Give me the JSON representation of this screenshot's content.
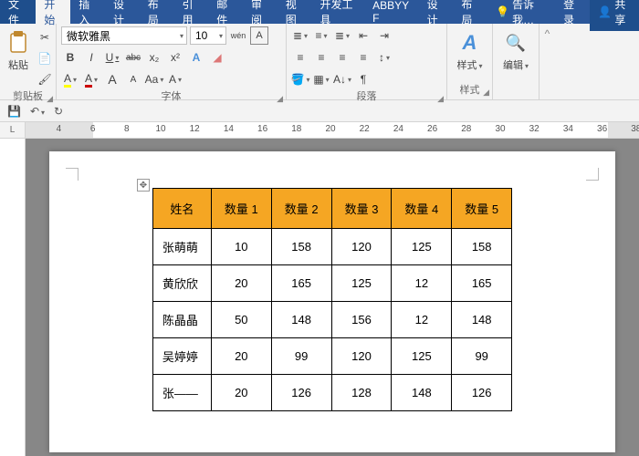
{
  "titlebar": {
    "file": "文件",
    "tabs": [
      "开始",
      "插入",
      "设计",
      "布局",
      "引用",
      "邮件",
      "审阅",
      "视图",
      "开发工具",
      "ABBYY F",
      "设计",
      "布局"
    ],
    "activeIndex": 0,
    "tell_me": "告诉我…",
    "login": "登录",
    "share": "共享"
  },
  "ribbon": {
    "clipboard": {
      "paste": "粘贴",
      "label": "剪贴板"
    },
    "font": {
      "name": "微软雅黑",
      "size": "10",
      "bold": "B",
      "italic": "I",
      "underline": "U",
      "strike": "abc",
      "sub": "x₂",
      "sup": "x²",
      "pinyin": "wén",
      "charborder": "A",
      "grow": "A",
      "shrink": "A",
      "clear": "A",
      "label": "字体"
    },
    "paragraph": {
      "label": "段落"
    },
    "styles": {
      "btn": "样式",
      "label": "样式"
    },
    "editing": {
      "btn": "编辑"
    }
  },
  "qat": {
    "save": "💾",
    "undo": "↶",
    "redo": "↻"
  },
  "ruler": {
    "start": 4,
    "end": 38,
    "corner": "L"
  },
  "table": {
    "headers": [
      "姓名",
      "数量 1",
      "数量 2",
      "数量 3",
      "数量 4",
      "数量 5"
    ],
    "rows": [
      {
        "name": "张萌萌",
        "v": [
          "10",
          "158",
          "120",
          "125",
          "158"
        ]
      },
      {
        "name": "黄欣欣",
        "v": [
          "20",
          "165",
          "125",
          "12",
          "165"
        ]
      },
      {
        "name": "陈晶晶",
        "v": [
          "50",
          "148",
          "156",
          "12",
          "148"
        ]
      },
      {
        "name": "吴婷婷",
        "v": [
          "20",
          "99",
          "120",
          "125",
          "99"
        ]
      },
      {
        "name": "张——",
        "v": [
          "20",
          "126",
          "128",
          "148",
          "126"
        ]
      }
    ]
  },
  "chart_data": {
    "type": "table",
    "title": "",
    "columns": [
      "姓名",
      "数量 1",
      "数量 2",
      "数量 3",
      "数量 4",
      "数量 5"
    ],
    "rows": [
      [
        "张萌萌",
        10,
        158,
        120,
        125,
        158
      ],
      [
        "黄欣欣",
        20,
        165,
        125,
        12,
        165
      ],
      [
        "陈晶晶",
        50,
        148,
        156,
        12,
        148
      ],
      [
        "吴婷婷",
        20,
        99,
        120,
        125,
        99
      ],
      [
        "张——",
        20,
        126,
        128,
        148,
        126
      ]
    ]
  }
}
